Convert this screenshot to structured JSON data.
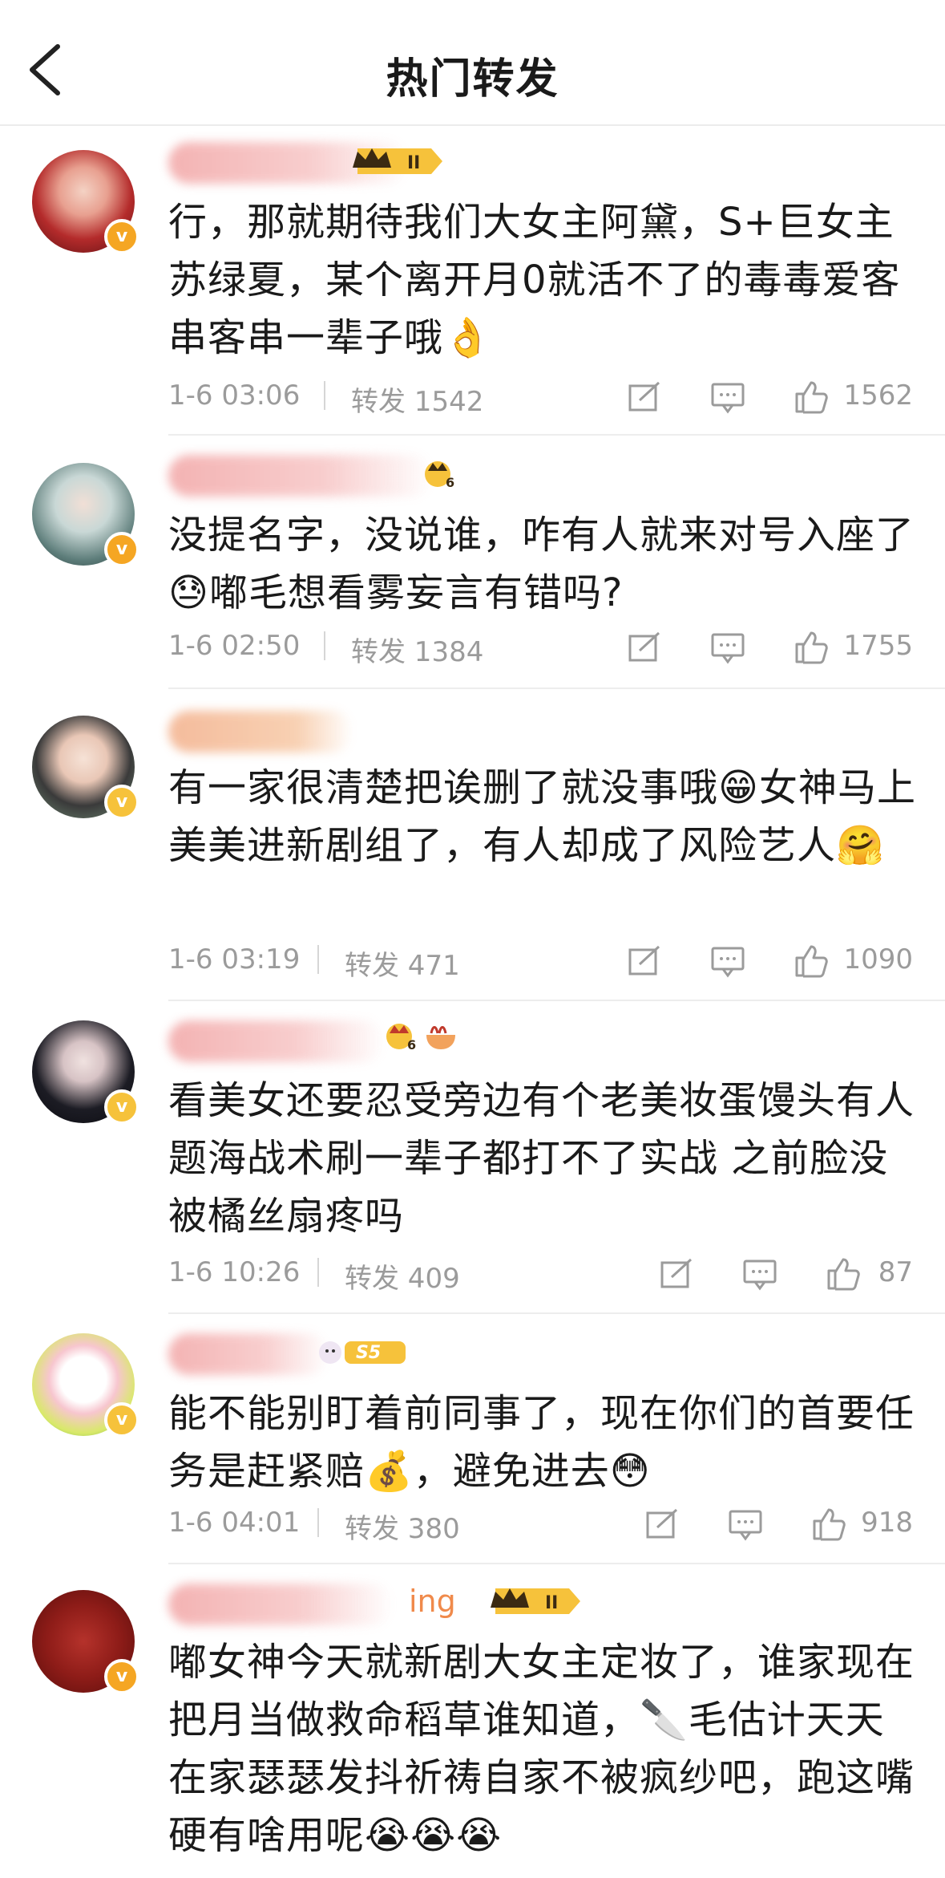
{
  "header": {
    "title": "热门转发"
  },
  "posts": [
    {
      "text": "行，那就期待我们大女主阿黛，S+巨女主苏绿夏，某个离开月0就活不了的毒毒爱客串客串一辈子哦👌",
      "time": "1-6 03:06",
      "repost": "转发 1542",
      "likes": "1562",
      "badge": "II"
    },
    {
      "text": "没提名字，没说谁，咋有人就来对号入座了😓嘟毛想看雾妄言有错吗?",
      "time": "1-6 02:50",
      "repost": "转发 1384",
      "likes": "1755",
      "badge": "6"
    },
    {
      "text": "有一家很清楚把诶删了就没事哦😁女神马上美美进新剧组了，有人却成了风险艺人🤗",
      "time": "1-6 03:19",
      "repost": "转发 471",
      "likes": "1090",
      "badge": ""
    },
    {
      "text": "看美女还要忍受旁边有个老美妆蛋馒头有人题海战术刷一辈子都打不了实战  之前脸没被橘丝扇疼吗",
      "time": "1-6 10:26",
      "repost": "转发 409",
      "likes": "87",
      "badge": "6"
    },
    {
      "text": "能不能别盯着前同事了，现在你们的首要任务是赶紧赔💰，避免进去😳",
      "time": "1-6 04:01",
      "repost": "转发 380",
      "likes": "918",
      "badge": "S5"
    },
    {
      "text": "嘟女神今天就新剧大女主定妆了，谁家现在把月当做救命稻草谁知道，🔪毛估计天天在家瑟瑟发抖祈祷自家不被疯纱吧，跑这嘴硬有啥用呢😭😭😭",
      "time": "",
      "repost": "",
      "likes": "",
      "badge": "II",
      "name_tail": "ing"
    }
  ],
  "colors": {
    "vip": "#f5a623",
    "meta": "#9b9b9b",
    "divider": "#ededed"
  },
  "icons": [
    "back-arrow-icon",
    "repost-icon",
    "comment-icon",
    "like-icon",
    "verified-icon"
  ]
}
